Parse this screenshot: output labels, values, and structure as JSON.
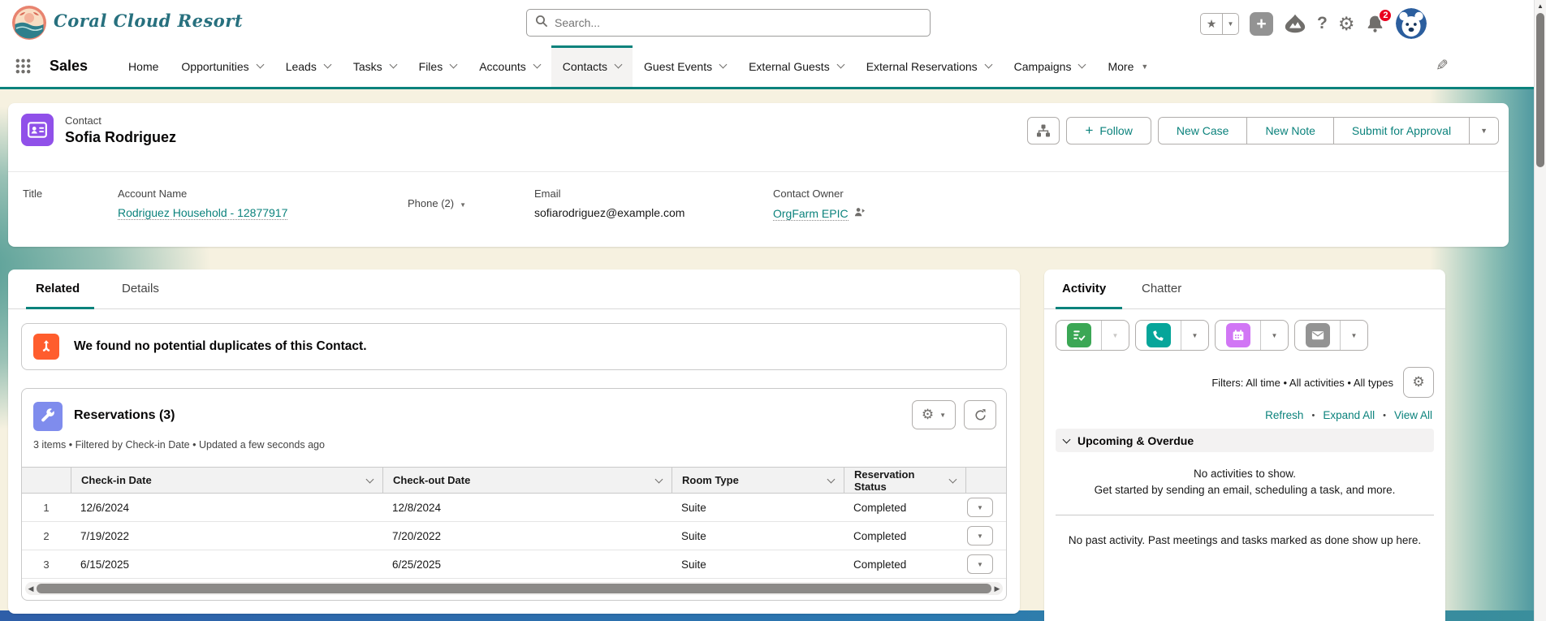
{
  "header": {
    "brand": "Coral Cloud Resort",
    "search_placeholder": "Search...",
    "notification_count": "2"
  },
  "icons": {
    "star": "★",
    "caret": "▼",
    "plus": "+",
    "help": "?",
    "gear": "⚙",
    "pencil": "✎",
    "bullet": "•"
  },
  "nav": {
    "app_name": "Sales",
    "tabs": [
      {
        "label": "Home"
      },
      {
        "label": "Opportunities"
      },
      {
        "label": "Leads"
      },
      {
        "label": "Tasks"
      },
      {
        "label": "Files"
      },
      {
        "label": "Accounts"
      },
      {
        "label": "Contacts",
        "active": true
      },
      {
        "label": "Guest Events"
      },
      {
        "label": "External Guests"
      },
      {
        "label": "External Reservations"
      },
      {
        "label": "Campaigns"
      },
      {
        "label": "More"
      }
    ]
  },
  "record": {
    "entity_label": "Contact",
    "name": "Sofia Rodriguez",
    "actions": {
      "follow": "Follow",
      "new_case": "New Case",
      "new_note": "New Note",
      "submit_for_approval": "Submit for Approval"
    },
    "fields": [
      {
        "label": "Title",
        "value": ""
      },
      {
        "label": "Account Name",
        "value": "Rodriguez Household - 12877917"
      },
      {
        "label": "Phone (2)",
        "value": ""
      },
      {
        "label": "Email",
        "value": "sofiarodriguez@example.com"
      },
      {
        "label": "Contact Owner",
        "value": "OrgFarm EPIC"
      }
    ]
  },
  "related": {
    "tabs": [
      "Related",
      "Details"
    ],
    "duplicates_message": "We found no potential duplicates of this Contact.",
    "reservations": {
      "title": "Reservations (3)",
      "meta": "3 items • Filtered by Check-in Date • Updated a few seconds ago",
      "columns": [
        "Check-in Date",
        "Check-out Date",
        "Room Type",
        "Reservation Status"
      ],
      "rows": [
        {
          "num": "1",
          "check_in": "12/6/2024",
          "check_out": "12/8/2024",
          "room_type": "Suite",
          "status": "Completed"
        },
        {
          "num": "2",
          "check_in": "7/19/2022",
          "check_out": "7/20/2022",
          "room_type": "Suite",
          "status": "Completed"
        },
        {
          "num": "3",
          "check_in": "6/15/2025",
          "check_out": "6/25/2025",
          "room_type": "Suite",
          "status": "Completed"
        }
      ]
    }
  },
  "activity": {
    "tabs": [
      "Activity",
      "Chatter"
    ],
    "filters_text": "Filters: All time • All activities • All types",
    "links": {
      "refresh": "Refresh",
      "expand_all": "Expand All",
      "view_all": "View All"
    },
    "section_title": "Upcoming & Overdue",
    "empty_title": "No activities to show.",
    "empty_subtitle": "Get started by sending an email, scheduling a task, and more.",
    "past_activity_text": "No past activity. Past meetings and tasks marked as done show up here."
  },
  "colors": {
    "brand_teal": "#0b827c",
    "link_teal": "#0b827c",
    "contact_icon": "#9050e9",
    "merge_icon": "#ff5d2d",
    "reservation_icon": "#7f8ced",
    "task_icon": "#3ba755",
    "call_icon": "#06a59a",
    "event_icon": "#d176f5",
    "email_icon": "#939393",
    "notification_badge": "#ea001e",
    "avatar_bg": "#2b5e9e",
    "bottom_wave": "#2e5ea8"
  }
}
